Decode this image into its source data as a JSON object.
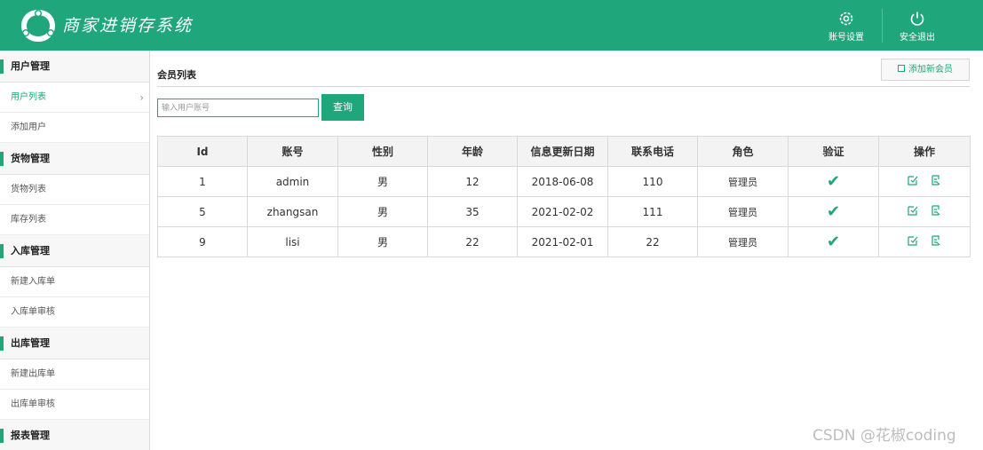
{
  "header": {
    "app_title": "商家进销存系统",
    "account_settings_label": "账号设置",
    "logout_label": "安全退出",
    "colors": {
      "brand": "#1fa67a"
    }
  },
  "sidebar": {
    "groups": [
      {
        "label": "用户管理",
        "items": [
          {
            "label": "用户列表",
            "active": true
          },
          {
            "label": "添加用户"
          }
        ]
      },
      {
        "label": "货物管理",
        "items": [
          {
            "label": "货物列表"
          },
          {
            "label": "库存列表"
          }
        ]
      },
      {
        "label": "入库管理",
        "items": [
          {
            "label": "新建入库单"
          },
          {
            "label": "入库单审核"
          }
        ]
      },
      {
        "label": "出库管理",
        "items": [
          {
            "label": "新建出库单"
          },
          {
            "label": "出库单审核"
          }
        ]
      },
      {
        "label": "报表管理",
        "items": []
      }
    ]
  },
  "main": {
    "title": "会员列表",
    "add_button_label": "添加新会员",
    "search": {
      "placeholder": "输入用户账号",
      "value": "",
      "button_label": "查询"
    },
    "table": {
      "headers": [
        "Id",
        "账号",
        "性别",
        "年龄",
        "信息更新日期",
        "联系电话",
        "角色",
        "验证",
        "操作"
      ],
      "rows": [
        {
          "id": "1",
          "account": "admin",
          "gender": "男",
          "age": "12",
          "updated": "2018-06-08",
          "phone": "110",
          "role": "管理员",
          "verified": true
        },
        {
          "id": "5",
          "account": "zhangsan",
          "gender": "男",
          "age": "35",
          "updated": "2021-02-02",
          "phone": "111",
          "role": "管理员",
          "verified": true
        },
        {
          "id": "9",
          "account": "lisi",
          "gender": "男",
          "age": "22",
          "updated": "2021-02-01",
          "phone": "22",
          "role": "管理员",
          "verified": true
        }
      ],
      "verified_glyph": "✔",
      "icons": {
        "edit": "edit-icon",
        "delete": "delete-icon"
      }
    }
  },
  "watermark": "CSDN @花椒coding"
}
